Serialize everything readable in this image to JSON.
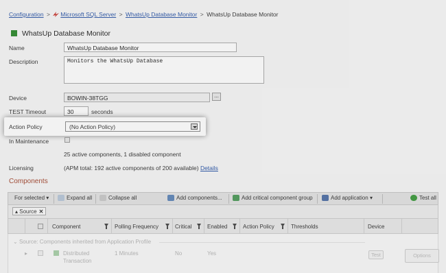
{
  "breadcrumb": {
    "items": [
      "Configuration",
      "Microsoft SQL Server",
      "WhatsUp Database Monitor"
    ],
    "current": "WhatsUp Database Monitor",
    "separator": ">"
  },
  "page_title": "WhatsUp Database Monitor",
  "form": {
    "name_label": "Name",
    "name_value": "WhatsUp Database Monitor",
    "description_label": "Description",
    "description_value": "Monitors the WhatsUp Database",
    "device_label": "Device",
    "device_value": "BOWIN-38TGG",
    "browse_label": "...",
    "timeout_label": "TEST Timeout",
    "timeout_value": "30",
    "timeout_unit": "seconds",
    "action_policy_label": "Action Policy",
    "action_policy_value": "(No Action Policy)",
    "maintenance_label": "In Maintenance",
    "components_summary": "25 active components, 1 disabled component",
    "licensing_label": "Licensing",
    "licensing_text": "(APM total: 192 active components of 200 available)",
    "licensing_link": "Details"
  },
  "components": {
    "section_title": "Components",
    "toolbar": {
      "for_selected": "For selected",
      "expand_all": "Expand all",
      "collapse_all": "Collapse all",
      "add_components": "Add components...",
      "add_critical_group": "Add critical component group",
      "add_application": "Add application",
      "test_all": "Test all"
    },
    "group_chip": "Source",
    "columns": [
      "Component",
      "Polling Frequency",
      "Critical",
      "Enabled",
      "Action Policy",
      "Thresholds",
      "Device"
    ],
    "group_row_label": "Source: Components inherited from Application Profile",
    "row": {
      "component": "Distributed Transaction",
      "polling": "1 Minutes",
      "critical": "No",
      "enabled": "Yes",
      "test_button": "Test",
      "options_button": "Options"
    }
  },
  "colors": {
    "link": "#2a55a8",
    "section": "#a4472f",
    "status_green": "#2d8a2d",
    "sql_icon_red": "#c8322a"
  }
}
